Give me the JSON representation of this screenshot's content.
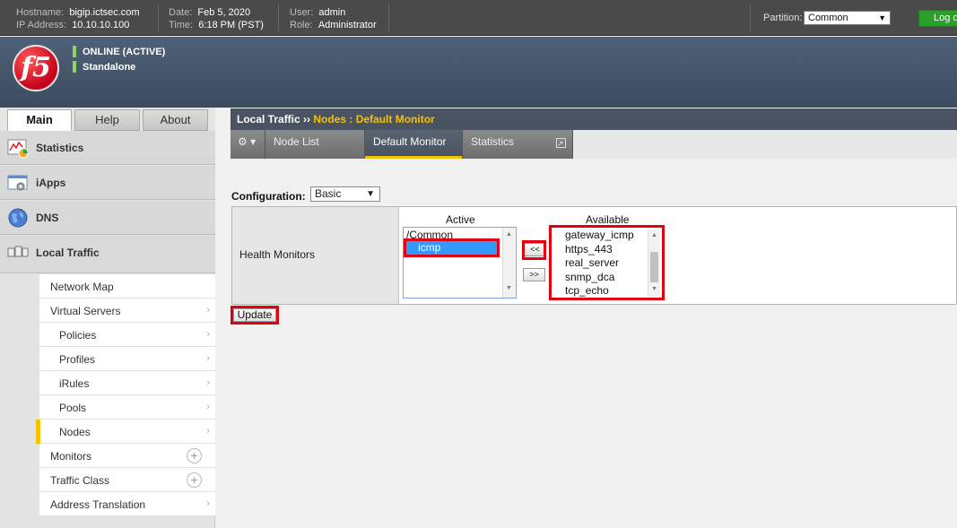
{
  "header": {
    "hostname_label": "Hostname:",
    "hostname": "bigip.ictsec.com",
    "ip_label": "IP Address:",
    "ip": "10.10.10.100",
    "date_label": "Date:",
    "date": "Feb 5, 2020",
    "time_label": "Time:",
    "time": "6:18 PM (PST)",
    "user_label": "User:",
    "user": "admin",
    "role_label": "Role:",
    "role": "Administrator",
    "partition_label": "Partition:",
    "partition_value": "Common",
    "logout_label": "Log o"
  },
  "banner": {
    "logo_text": "f5",
    "status_online": "ONLINE (ACTIVE)",
    "status_mode": "Standalone",
    "status_color": "#8cd36b"
  },
  "left_tabs": [
    "Main",
    "Help",
    "About"
  ],
  "nav": {
    "sections": [
      {
        "label": "Statistics",
        "icon": "statistics-icon"
      },
      {
        "label": "iApps",
        "icon": "iapps-icon"
      },
      {
        "label": "DNS",
        "icon": "dns-globe-icon"
      },
      {
        "label": "Local Traffic",
        "icon": "local-traffic-icon"
      }
    ],
    "local_traffic_items": [
      {
        "label": "Network Map",
        "marker": ""
      },
      {
        "label": "Virtual Servers",
        "marker": "›"
      },
      {
        "label": "Policies",
        "marker": "›"
      },
      {
        "label": "Profiles",
        "marker": "›"
      },
      {
        "label": "iRules",
        "marker": "›"
      },
      {
        "label": "Pools",
        "marker": "›"
      },
      {
        "label": "Nodes",
        "marker": "›"
      },
      {
        "label": "Monitors",
        "marker": "+"
      },
      {
        "label": "Traffic Class",
        "marker": "+"
      },
      {
        "label": "Address Translation",
        "marker": "›"
      }
    ]
  },
  "breadcrumb": {
    "section": "Local Traffic",
    "separator": "››",
    "current": "Nodes : Default Monitor"
  },
  "tabs": {
    "gear": "⚙ ▾",
    "items": [
      "Node List",
      "Default Monitor",
      "Statistics"
    ],
    "active": "Default Monitor"
  },
  "config": {
    "label": "Configuration:",
    "value": "Basic"
  },
  "health_monitors": {
    "label": "Health Monitors",
    "active_heading": "Active",
    "available_heading": "Available",
    "active_group": "/Common",
    "active_items": [
      "icmp"
    ],
    "available_items": [
      "gateway_icmp",
      "https_443",
      "real_server",
      "snmp_dca",
      "tcp_echo"
    ],
    "move_left": "<<",
    "move_right": ">>"
  },
  "update_label": "Update",
  "highlight_color": "#e00010"
}
